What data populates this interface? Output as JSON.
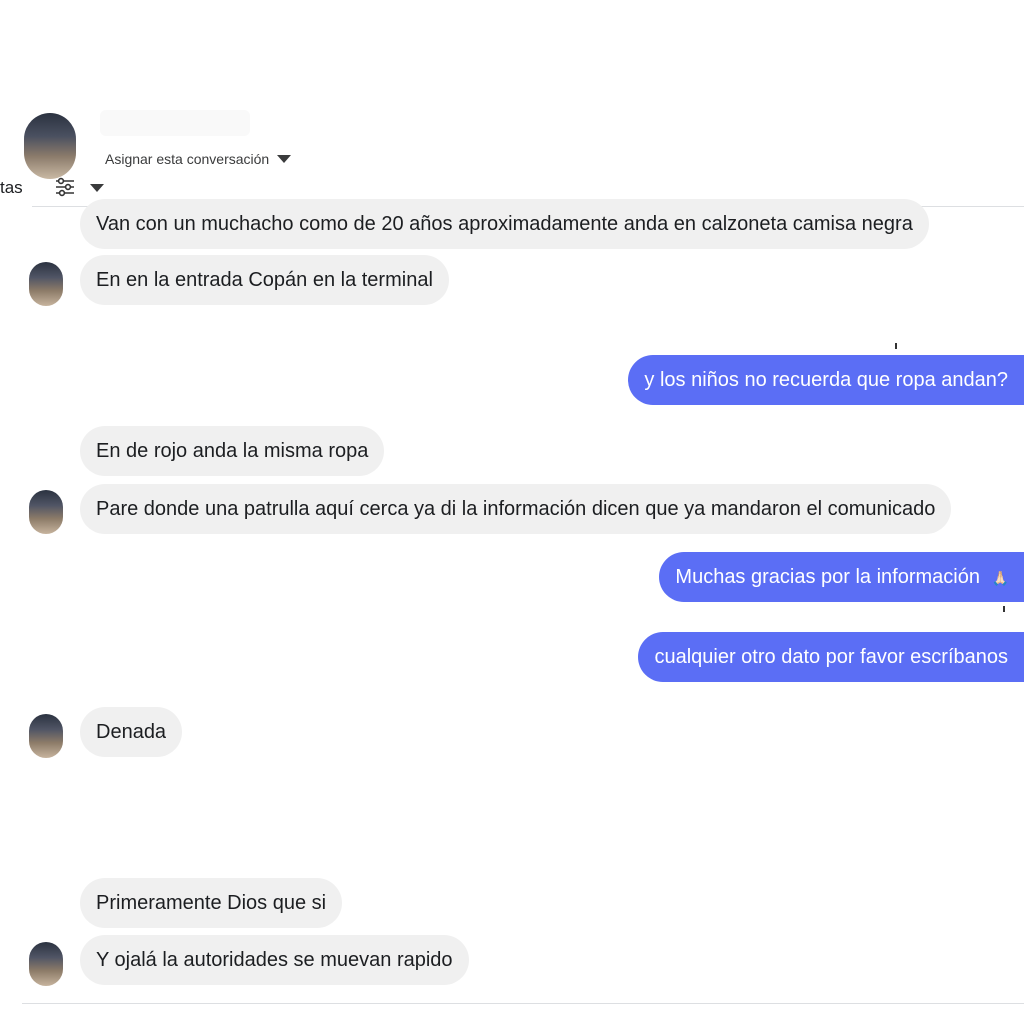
{
  "header": {
    "assign_label": "Asignar esta conversación",
    "tab_fragment": "tas"
  },
  "messages": [
    {
      "side": "in",
      "text": "Van con un muchacho como de 20 años aproximadamente anda en calzoneta camisa negra"
    },
    {
      "side": "in",
      "text": "En en la entrada Copán en la terminal"
    },
    {
      "side": "out",
      "text": "y los niños no recuerda que ropa andan?"
    },
    {
      "side": "in",
      "text": "En de rojo anda la misma ropa"
    },
    {
      "side": "in",
      "text": "Pare donde una patrulla aquí cerca ya di la información dicen que ya mandaron el comunicado"
    },
    {
      "side": "out",
      "text": "Muchas gracias por la información",
      "emoji": "🙏🏻"
    },
    {
      "side": "out",
      "text": "cualquier otro dato por favor escríbanos"
    },
    {
      "side": "in",
      "text": "Denada"
    },
    {
      "side": "in",
      "text": "Primeramente Dios que si"
    },
    {
      "side": "in",
      "text": "Y ojalá la autoridades se muevan rapido"
    }
  ]
}
